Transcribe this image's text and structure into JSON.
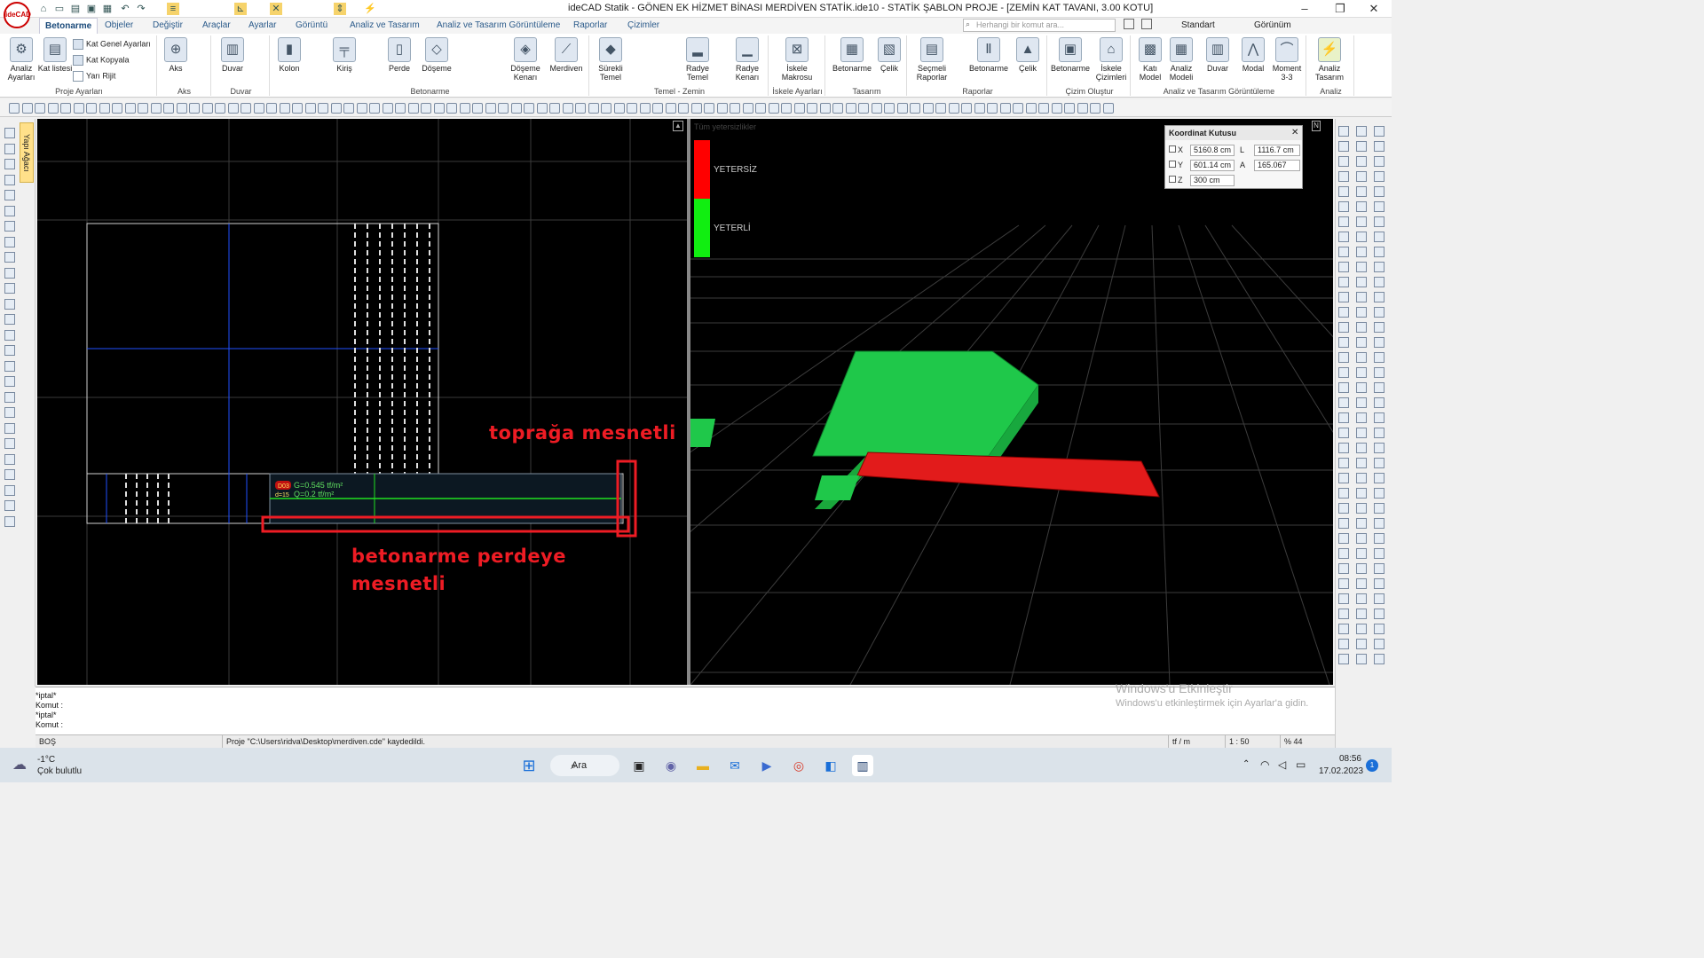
{
  "app": {
    "title": "ideCAD Statik - GÖNEN EK HİZMET BİNASI MERDİVEN STATİK.ide10 - STATİK ŞABLON PROJE - [ZEMİN KAT TAVANI,  3.00 KOTU]",
    "logo": "ideCAD"
  },
  "menu_tabs": [
    "Betonarme",
    "Objeler",
    "Değiştir",
    "Araçlar",
    "Ayarlar",
    "Görüntü",
    "Analiz ve Tasarım",
    "Analiz ve Tasarım Görüntüleme",
    "Raporlar",
    "Çizimler"
  ],
  "command_search": {
    "placeholder": "Herhangi bir komut ara..."
  },
  "standard_select": "Standart",
  "gorunum_menu": "Görünüm",
  "ribbon": {
    "proje": {
      "label": "Proje Ayarları",
      "analiz": "Analiz Ayarları",
      "kat": "Kat listesi",
      "kat_genel": "Kat Genel Ayarları",
      "kat_kopyala": "Kat Kopyala",
      "yari_rijit": "Yarı Rijit"
    },
    "aks": {
      "label": "Aks",
      "btn": "Aks"
    },
    "duvar": {
      "label": "Duvar",
      "btn": "Duvar"
    },
    "betonarme": {
      "label": "Betonarme",
      "kolon": "Kolon",
      "kiris": "Kiriş",
      "perde": "Perde",
      "doseme": "Döşeme",
      "doseme_kenari": "Döşeme Kenarı",
      "merdiven": "Merdiven"
    },
    "temel": {
      "label": "Temel - Zemin",
      "surekli": "Sürekli Temel",
      "radye": "Radye Temel",
      "radye_kenari": "Radye Kenarı"
    },
    "iskele": {
      "label": "İskele Ayarları",
      "btn": "İskele Makrosu"
    },
    "tasarim": {
      "label": "Tasarım",
      "betonarme": "Betonarme",
      "celik": "Çelik"
    },
    "raporlar": {
      "label": "Raporlar",
      "secmeli": "Seçmeli Raporlar",
      "betonarme": "Betonarme",
      "celik": "Çelik"
    },
    "cizim": {
      "label": "Çizim Oluştur",
      "betonarme": "Betonarme",
      "iskele": "İskele Çizimleri"
    },
    "analiz_gor": {
      "label": "Analiz ve Tasarım Görüntüleme",
      "kati": "Katı Model",
      "analiz_modeli": "Analiz Modeli",
      "duvar": "Duvar",
      "modal": "Modal",
      "moment": "Moment 3-3"
    },
    "analiz": {
      "label": "Analiz",
      "btn": "Analiz Tasarım"
    }
  },
  "left_panel": {
    "yapi_agaci": "Yapı Ağacı"
  },
  "plan": {
    "slab_id": "D03",
    "slab_thk": "d=15",
    "load_g": "G=0.545 tf/m²",
    "load_q": "Q=0.2 tf/m²"
  },
  "annotations": {
    "toprak": "toprağa mesnetli",
    "perde_line1": "betonarme perdeye",
    "perde_line2": "mesnetli"
  },
  "legend": {
    "caption": "Tüm yetersizlikler",
    "yetersiz": "YETERSİZ",
    "yeterli": "YETERLİ",
    "colors": {
      "yetersiz": "#ff0000",
      "yeterli": "#11ee11"
    }
  },
  "coordinate_box": {
    "title": "Koordinat Kutusu",
    "x_label": "X",
    "x": "5160.8 cm",
    "y_label": "Y",
    "y": "601.14 cm",
    "z_label": "Z",
    "z": "300 cm",
    "l_label": "L",
    "l": "1116.7 cm",
    "a_label": "A",
    "a": "165.067"
  },
  "command_history": [
    "*iptal*",
    "Komut :",
    "*iptal*",
    "Komut :"
  ],
  "watermark": {
    "line1": "Windows'u Etkinleştir",
    "line2": "Windows'u etkinleştirmek için Ayarlar'a gidin."
  },
  "status": {
    "mode": "BOŞ",
    "message": "Proje \"C:\\Users\\ridva\\Desktop\\merdiven.cde\" kaydedildi.",
    "unit": "tf / m",
    "scale": "1 : 50",
    "zoom": "% 44"
  },
  "taskbar": {
    "weather_temp": "-1°C",
    "weather_desc": "Çok bulutlu",
    "search": "Ara",
    "time": "08:56",
    "date": "17.02.2023",
    "notif": "1"
  }
}
